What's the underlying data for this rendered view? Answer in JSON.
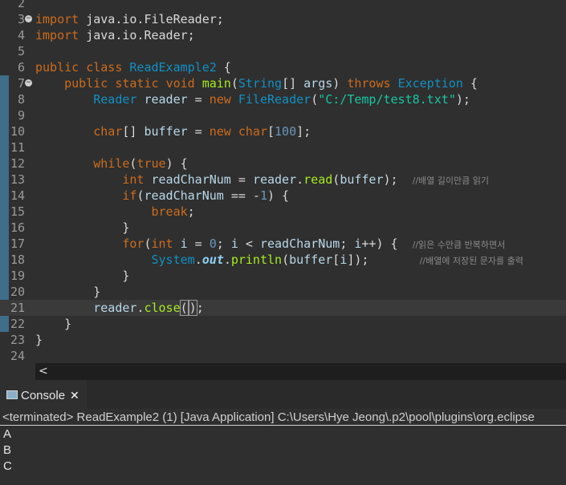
{
  "editor": {
    "lines": [
      {
        "n": "2",
        "fold": false,
        "html": ""
      },
      {
        "n": "3",
        "fold": true,
        "html": "<span class=\"kw\">import</span> java.io.FileReader;"
      },
      {
        "n": "4",
        "fold": false,
        "html": "<span class=\"kw\">import</span> java.io.Reader;"
      },
      {
        "n": "5",
        "fold": false,
        "html": ""
      },
      {
        "n": "6",
        "fold": false,
        "html": "<span class=\"kw\">public</span> <span class=\"kw\">class</span> <span class=\"cls\">ReadExample2</span> {"
      },
      {
        "n": "7",
        "fold": true,
        "html": "    <span class=\"kw\">public</span> <span class=\"kw\">static</span> <span class=\"kw\">void</span> <span class=\"mth\">main</span>(<span class=\"cls\">String</span>[] <span class=\"fld\">args</span>) <span class=\"kw\">throws</span> <span class=\"cls\">Exception</span> {"
      },
      {
        "n": "8",
        "fold": false,
        "html": "        <span class=\"cls\">Reader</span> <span class=\"fld\">reader</span> = <span class=\"kw\">new</span> <span class=\"cls\">FileReader</span>(<span class=\"str\">\"C:/Temp/test8.txt\"</span>);"
      },
      {
        "n": "9",
        "fold": false,
        "html": ""
      },
      {
        "n": "10",
        "fold": false,
        "html": "        <span class=\"kw\">char</span>[] <span class=\"fld\">buffer</span> = <span class=\"kw\">new</span> <span class=\"kw\">char</span>[<span class=\"num\">100</span>];"
      },
      {
        "n": "11",
        "fold": false,
        "html": ""
      },
      {
        "n": "12",
        "fold": false,
        "html": "        <span class=\"kw\">while</span>(<span class=\"kw\">true</span>) {"
      },
      {
        "n": "13",
        "fold": false,
        "html": "            <span class=\"kw\">int</span> <span class=\"fld\">readCharNum</span> = <span class=\"fld\">reader</span>.<span class=\"mth\">read</span>(<span class=\"fld\">buffer</span>);  <span class=\"cmt\">//배열 길이만큼 읽기</span>"
      },
      {
        "n": "14",
        "fold": false,
        "html": "            <span class=\"kw\">if</span>(<span class=\"fld\">readCharNum</span> == -<span class=\"num\">1</span>) {"
      },
      {
        "n": "15",
        "fold": false,
        "html": "                <span class=\"kw\">break</span>;"
      },
      {
        "n": "16",
        "fold": false,
        "html": "            }"
      },
      {
        "n": "17",
        "fold": false,
        "html": "            <span class=\"kw\">for</span>(<span class=\"kw\">int</span> <span class=\"fld\">i</span> = <span class=\"num\">0</span>; <span class=\"fld\">i</span> &lt; <span class=\"fld\">readCharNum</span>; <span class=\"fld\">i</span>++) {  <span class=\"cmt\">//읽은 수만큼 반복하면서</span>"
      },
      {
        "n": "18",
        "fold": false,
        "html": "                <span class=\"cls\">System</span>.<span class=\"bold-it\">out</span>.<span class=\"mth\">println</span>(<span class=\"fld\">buffer</span>[<span class=\"fld\">i</span>]);       <span class=\"cmt\">//배열에 저장된 문자를 출력</span>"
      },
      {
        "n": "19",
        "fold": false,
        "html": "            }"
      },
      {
        "n": "20",
        "fold": false,
        "html": "        }"
      },
      {
        "n": "21",
        "fold": false,
        "html": "        <span class=\"fld\">reader</span>.<span class=\"mth\">close</span><span class=\"bracket\">(</span><span class=\"caret\"></span><span class=\"bracket\">)</span>;",
        "current": true
      },
      {
        "n": "22",
        "fold": false,
        "html": "    }"
      },
      {
        "n": "23",
        "fold": false,
        "html": "}"
      },
      {
        "n": "24",
        "fold": false,
        "html": ""
      }
    ]
  },
  "scroll": {
    "left_arrow": "<"
  },
  "console": {
    "tab_label": "Console",
    "tab_close": "✕",
    "status": "<terminated> ReadExample2 (1) [Java Application] C:\\Users\\Hye Jeong\\.p2\\pool\\plugins\\org.eclipse",
    "output": [
      "A",
      "B",
      "C"
    ]
  },
  "colors": {
    "keyword": "#cc6c1d",
    "class": "#1290c3",
    "string": "#17c6a3",
    "comment": "#8a8a8a",
    "change_bar": "#3f6d8a"
  }
}
